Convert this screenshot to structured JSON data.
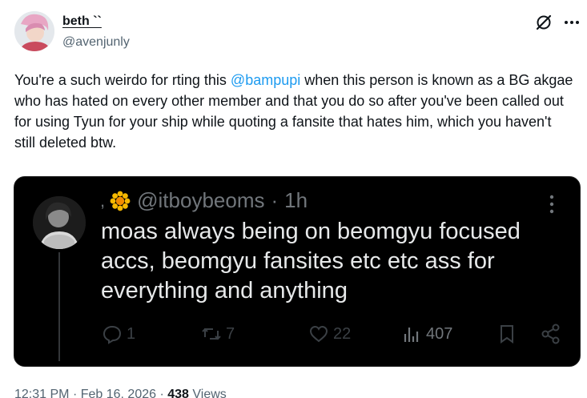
{
  "tweet": {
    "author": {
      "display_name": "beth ``",
      "handle": "@avenjunly"
    },
    "text_parts": [
      "You're a such weirdo for rting this ",
      "@bampupi",
      " when this person is known as a BG akgae who has hated on every other member and that you do so after you've been called out for using Tyun for your ship while quoting a fansite that hates him, which you haven't still deleted btw."
    ],
    "time": "12:31 PM",
    "dot1": "·",
    "date": "Feb 16, 2026",
    "dot2": "·",
    "views": "438",
    "views_label": "Views"
  },
  "quoted": {
    "prefix": ",",
    "handle": "@itboybeoms",
    "dot": "·",
    "age": "1h",
    "text": "moas always being on beomgyu focused accs, beomgyu fansites etc etc ass for everything and anything",
    "actions": {
      "replies": "1",
      "reposts": "7",
      "likes": "22",
      "views": "407"
    }
  },
  "colors": {
    "link": "#1d9bf0",
    "muted": "#536471",
    "quote_bg": "#000000",
    "quote_text": "#e7e9ea"
  },
  "icons": [
    "grok-icon",
    "more-icon",
    "sun-emoji-icon",
    "reply-icon",
    "repost-icon",
    "like-icon",
    "views-icon",
    "bookmark-icon",
    "share-icon"
  ]
}
